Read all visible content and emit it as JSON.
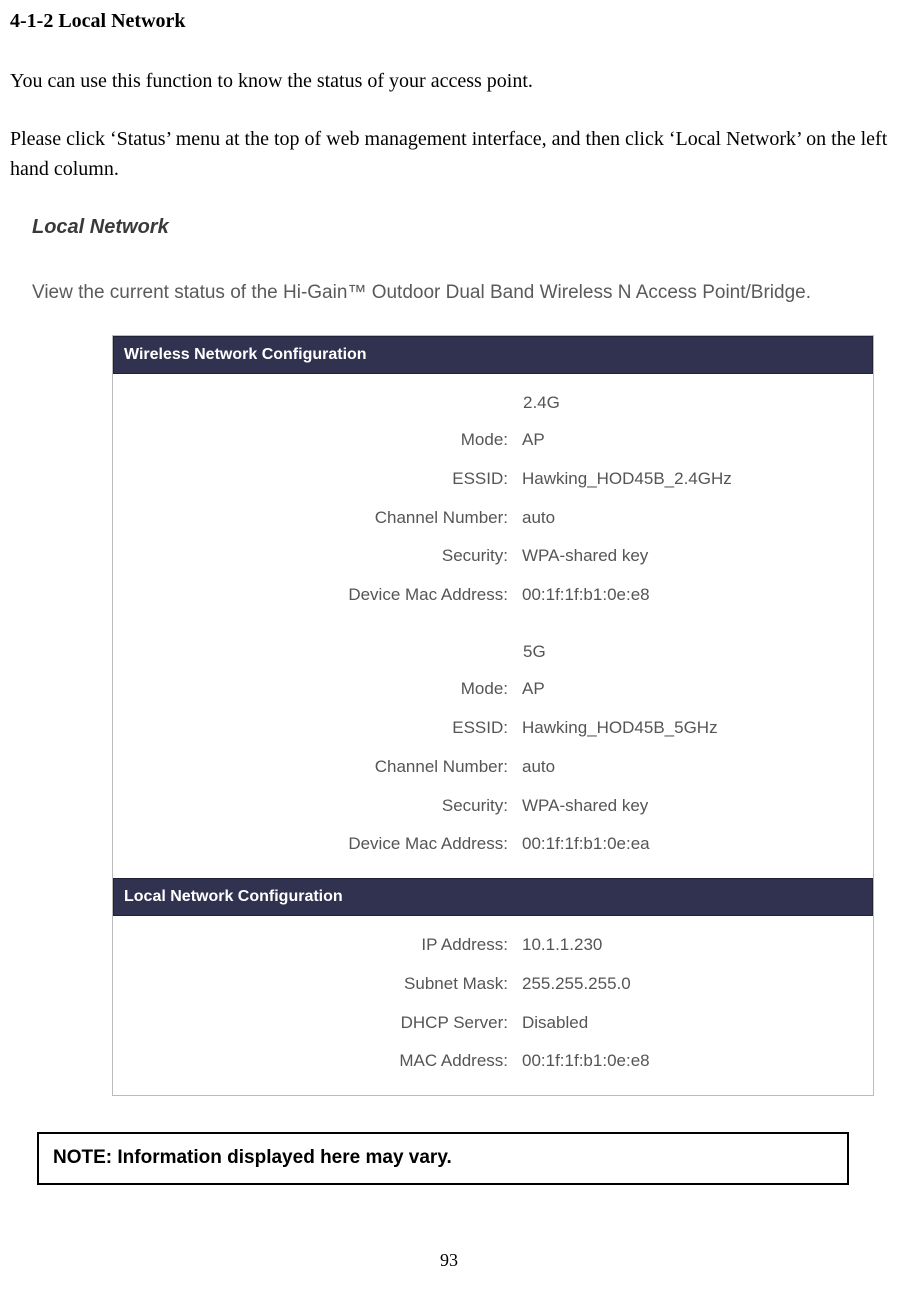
{
  "section_title": "4-1-2 Local Network",
  "intro_paragraph": "You can use this function to know the status of your access point.",
  "instruction_paragraph": "Please click ‘Status’ menu at the top of web management interface, and then click ‘Local Network’ on the left hand column.",
  "screenshot": {
    "title": "Local Network",
    "description": "View the current status of the Hi-Gain™ Outdoor Dual Band Wireless N Access Point/Bridge.",
    "wireless_panel": {
      "header": "Wireless Network Configuration",
      "band_24": {
        "label": "2.4G",
        "mode": {
          "label": "Mode:",
          "value": "AP"
        },
        "essid": {
          "label": "ESSID:",
          "value": "Hawking_HOD45B_2.4GHz"
        },
        "channel": {
          "label": "Channel Number:",
          "value": "auto"
        },
        "security": {
          "label": "Security:",
          "value": "WPA-shared key"
        },
        "mac": {
          "label": "Device Mac Address:",
          "value": "00:1f:1f:b1:0e:e8"
        }
      },
      "band_5": {
        "label": "5G",
        "mode": {
          "label": "Mode:",
          "value": "AP"
        },
        "essid": {
          "label": "ESSID:",
          "value": "Hawking_HOD45B_5GHz"
        },
        "channel": {
          "label": "Channel Number:",
          "value": "auto"
        },
        "security": {
          "label": "Security:",
          "value": "WPA-shared key"
        },
        "mac": {
          "label": "Device Mac Address:",
          "value": "00:1f:1f:b1:0e:ea"
        }
      }
    },
    "local_panel": {
      "header": "Local Network Configuration",
      "ip": {
        "label": "IP Address:",
        "value": "10.1.1.230"
      },
      "subnet": {
        "label": "Subnet Mask:",
        "value": "255.255.255.0"
      },
      "dhcp": {
        "label": "DHCP Server:",
        "value": "Disabled"
      },
      "mac": {
        "label": "MAC Address:",
        "value": "00:1f:1f:b1:0e:e8"
      }
    }
  },
  "note": "NOTE: Information displayed here may vary.",
  "page_number": "93"
}
